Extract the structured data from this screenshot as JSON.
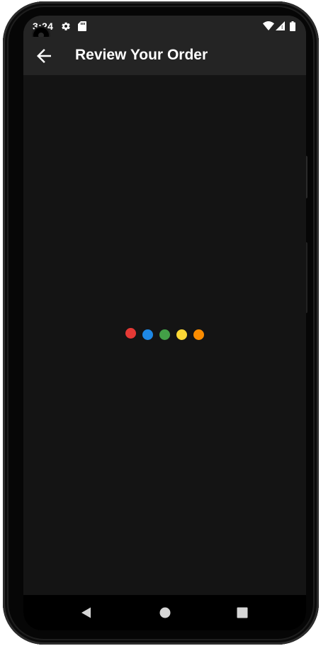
{
  "status_bar": {
    "time": "3:24",
    "icons": [
      "settings-gear-icon",
      "sd-card-icon",
      "wifi-icon",
      "cell-signal-icon",
      "battery-icon"
    ]
  },
  "app_bar": {
    "back_icon": "arrow-back-icon",
    "title": "Review Your Order"
  },
  "loader": {
    "dot_colors": [
      "#e53935",
      "#1e88e5",
      "#43a047",
      "#fdd835",
      "#fb8c00"
    ]
  },
  "nav_bar": {
    "buttons": [
      "back-triangle-icon",
      "home-circle-icon",
      "recents-square-icon"
    ]
  },
  "colors": {
    "background": "#141414",
    "app_bar": "#242424",
    "text": "#ffffff"
  }
}
